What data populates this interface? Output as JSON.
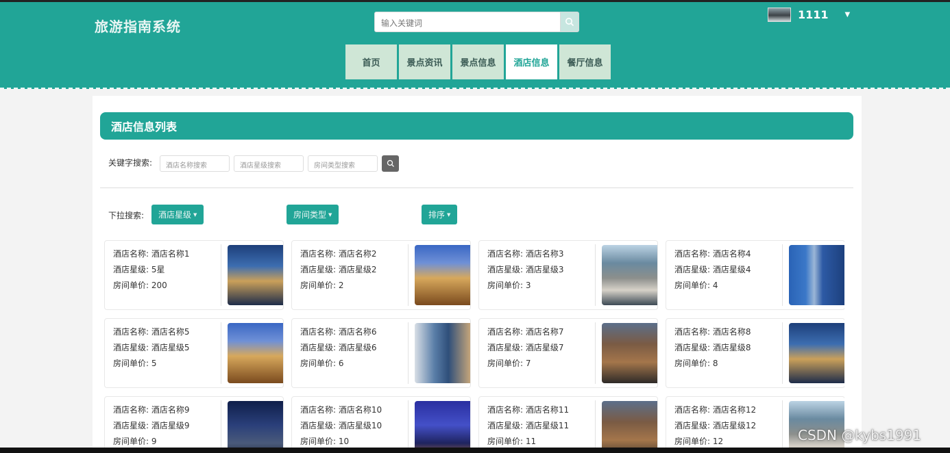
{
  "header": {
    "site_title": "旅游指南系统",
    "search_placeholder": "输入关键词",
    "username": "1111"
  },
  "nav": [
    {
      "label": "首页",
      "active": false
    },
    {
      "label": "景点资讯",
      "active": false
    },
    {
      "label": "景点信息",
      "active": false
    },
    {
      "label": "酒店信息",
      "active": true
    },
    {
      "label": "餐厅信息",
      "active": false
    }
  ],
  "panel": {
    "title": "酒店信息列表",
    "keyword_label": "关键字搜索:",
    "keyword_placeholders": [
      "酒店名称搜索",
      "酒店星级搜索",
      "房间类型搜索"
    ],
    "dropdown_label": "下拉搜索:",
    "dropdowns": [
      "酒店星级",
      "房间类型",
      "排序"
    ]
  },
  "hotels": [
    {
      "name": "酒店名称: 酒店名称1",
      "star": "酒店星级: 5星",
      "price": "房间单价: 200"
    },
    {
      "name": "酒店名称: 酒店名称2",
      "star": "酒店星级: 酒店星级2",
      "price": "房间单价: 2"
    },
    {
      "name": "酒店名称: 酒店名称3",
      "star": "酒店星级: 酒店星级3",
      "price": "房间单价: 3"
    },
    {
      "name": "酒店名称: 酒店名称4",
      "star": "酒店星级: 酒店星级4",
      "price": "房间单价: 4"
    },
    {
      "name": "酒店名称: 酒店名称5",
      "star": "酒店星级: 酒店星级5",
      "price": "房间单价: 5"
    },
    {
      "name": "酒店名称: 酒店名称6",
      "star": "酒店星级: 酒店星级6",
      "price": "房间单价: 6"
    },
    {
      "name": "酒店名称: 酒店名称7",
      "star": "酒店星级: 酒店星级7",
      "price": "房间单价: 7"
    },
    {
      "name": "酒店名称: 酒店名称8",
      "star": "酒店星级: 酒店星级8",
      "price": "房间单价: 8"
    },
    {
      "name": "酒店名称: 酒店名称9",
      "star": "酒店星级: 酒店星级9",
      "price": "房间单价: 9"
    },
    {
      "name": "酒店名称: 酒店名称10",
      "star": "酒店星级: 酒店星级10",
      "price": "房间单价: 10"
    },
    {
      "name": "酒店名称: 酒店名称11",
      "star": "酒店星级: 酒店星级11",
      "price": "房间单价: 11"
    },
    {
      "name": "酒店名称: 酒店名称12",
      "star": "酒店星级: 酒店星级12",
      "price": "房间单价: 12"
    }
  ],
  "watermark": "CSDN @kybs1991",
  "colors": {
    "accent": "#21a597",
    "nav_bg": "#cfe6d6"
  }
}
